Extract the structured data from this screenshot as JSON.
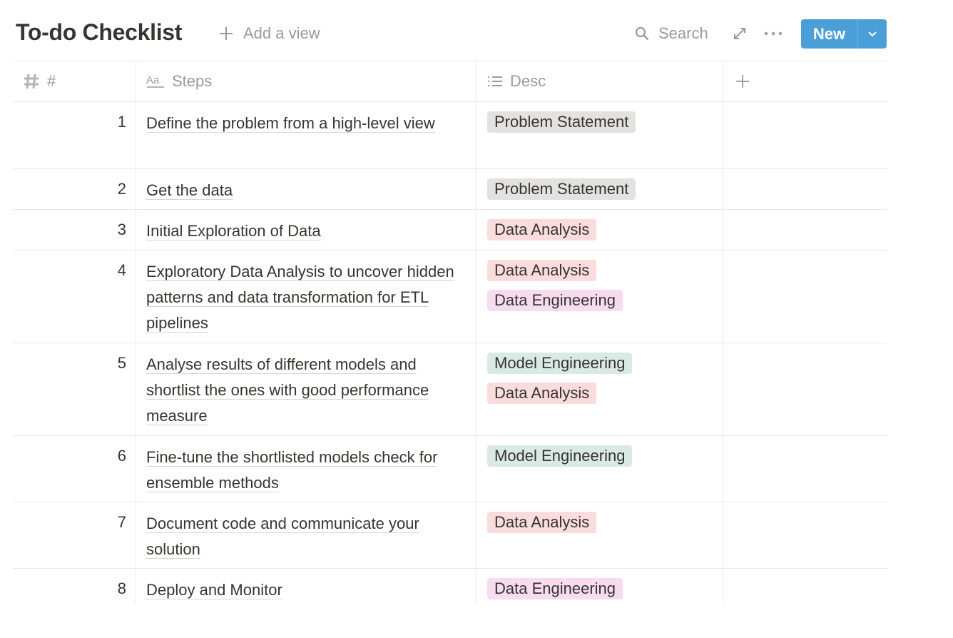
{
  "header": {
    "title": "To-do Checklist",
    "add_view_label": "Add a view",
    "search_label": "Search",
    "new_label": "New"
  },
  "table": {
    "columns": [
      {
        "label": "#",
        "icon": "number-icon"
      },
      {
        "label": "Steps",
        "icon": "text-property-icon"
      },
      {
        "label": "Desc",
        "icon": "multi-select-icon"
      }
    ],
    "rows": [
      {
        "num": "1",
        "step": "Define the problem from a high-level view",
        "tags": [
          "Problem Statement"
        ]
      },
      {
        "num": "2",
        "step": "Get the data",
        "tags": [
          "Problem Statement"
        ]
      },
      {
        "num": "3",
        "step": "Initial Exploration of Data",
        "tags": [
          "Data Analysis"
        ]
      },
      {
        "num": "4",
        "step": "Exploratory Data Analysis to uncover hidden patterns and data transformation for ETL pipelines",
        "tags": [
          "Data Analysis",
          "Data Engineering"
        ]
      },
      {
        "num": "5",
        "step": "Analyse results of different models and shortlist the ones with good performance measure",
        "tags": [
          "Model Engineering",
          "Data Analysis"
        ]
      },
      {
        "num": "6",
        "step": "Fine-tune the shortlisted models check for ensemble methods",
        "tags": [
          "Model Engineering"
        ]
      },
      {
        "num": "7",
        "step": "Document code and communicate your solution",
        "tags": [
          "Data Analysis"
        ]
      },
      {
        "num": "8",
        "step": "Deploy and Monitor",
        "tags": [
          "Data Engineering"
        ]
      }
    ]
  },
  "colors": {
    "accent": "#4a9fd8",
    "problem_statement": "#e3e2e0",
    "data_analysis": "#fadcdc",
    "data_engineering": "#f6dcee",
    "model_engineering": "#d8eae3"
  }
}
